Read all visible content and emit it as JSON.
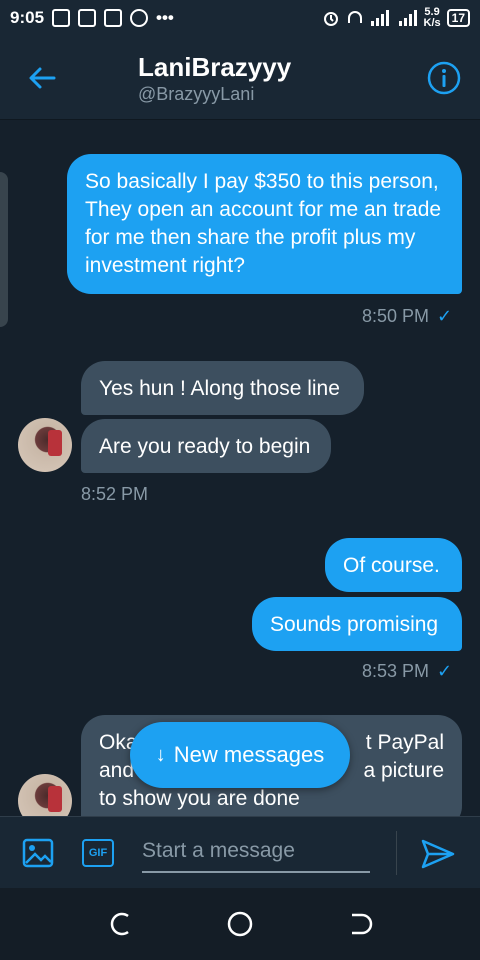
{
  "status_bar": {
    "time": "9:05",
    "dots": "•••",
    "speed_value": "5.9",
    "speed_unit": "K/s",
    "battery": "17"
  },
  "header": {
    "name": "LaniBrazyyy",
    "handle": "@BrazyyyLani"
  },
  "messages": [
    {
      "direction": "out",
      "text": "So basically I pay $350 to this person, They open an account for me an trade for me then share the profit plus my investment right?"
    },
    {
      "direction": "out_time",
      "text": "8:50 PM"
    },
    {
      "direction": "in",
      "text": "Yes hun ! Along those line"
    },
    {
      "direction": "in",
      "text": "Are you ready to begin"
    },
    {
      "direction": "in_time",
      "text": "8:52 PM"
    },
    {
      "direction": "out",
      "text": "Of course."
    },
    {
      "direction": "out",
      "text": "Sounds promising"
    },
    {
      "direction": "out_time",
      "text": "8:53 PM"
    },
    {
      "direction": "in",
      "line1_left": "Oka",
      "line1_right": "t PayPal",
      "line2_left": "and",
      "line2_right": "a picture",
      "line3": "to show you are done"
    }
  ],
  "new_messages_pill": {
    "arrow": "↓",
    "label": "New messages"
  },
  "composer": {
    "gif_label": "GIF",
    "placeholder": "Start a message"
  },
  "icons": {
    "back": "arrow-left-icon",
    "info": "info-icon",
    "image": "image-icon",
    "send": "send-icon",
    "check": "✓"
  },
  "colors": {
    "background": "#15202b",
    "accent": "#1da1f2",
    "incoming_bubble": "#3d4f5f",
    "secondary_text": "#8899a6"
  }
}
